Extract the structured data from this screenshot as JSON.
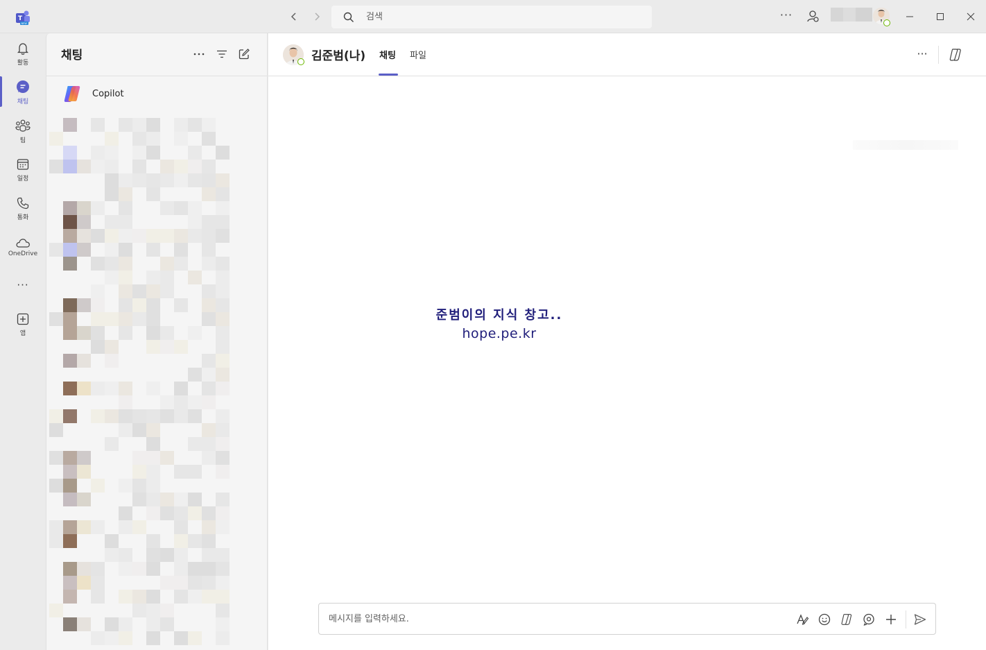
{
  "titlebar": {
    "search_placeholder": "검색",
    "more_label": "···"
  },
  "rail": {
    "items": [
      {
        "label": "활동",
        "icon": "bell-icon"
      },
      {
        "label": "채팅",
        "icon": "chat-icon"
      },
      {
        "label": "팀",
        "icon": "teams-icon"
      },
      {
        "label": "일정",
        "icon": "calendar-icon"
      },
      {
        "label": "통화",
        "icon": "phone-icon"
      },
      {
        "label": "OneDrive",
        "icon": "cloud-icon"
      },
      {
        "label": "앱",
        "icon": "add-app-icon"
      }
    ],
    "more_label": "···"
  },
  "list": {
    "title": "채팅",
    "copilot_name": "Copilot"
  },
  "chat": {
    "name": "김준범(나)",
    "tabs": [
      {
        "label": "채팅"
      },
      {
        "label": "파일"
      }
    ],
    "more_label": "···"
  },
  "watermark": {
    "line1": "준범이의 지식 창고..",
    "line2": "hope.pe.kr"
  },
  "composer": {
    "placeholder": "메시지를 입력하세요."
  },
  "colors": {
    "accent": "#5b5fc7",
    "presence_available": "#6bb700",
    "watermark": "#1f1d7a"
  }
}
